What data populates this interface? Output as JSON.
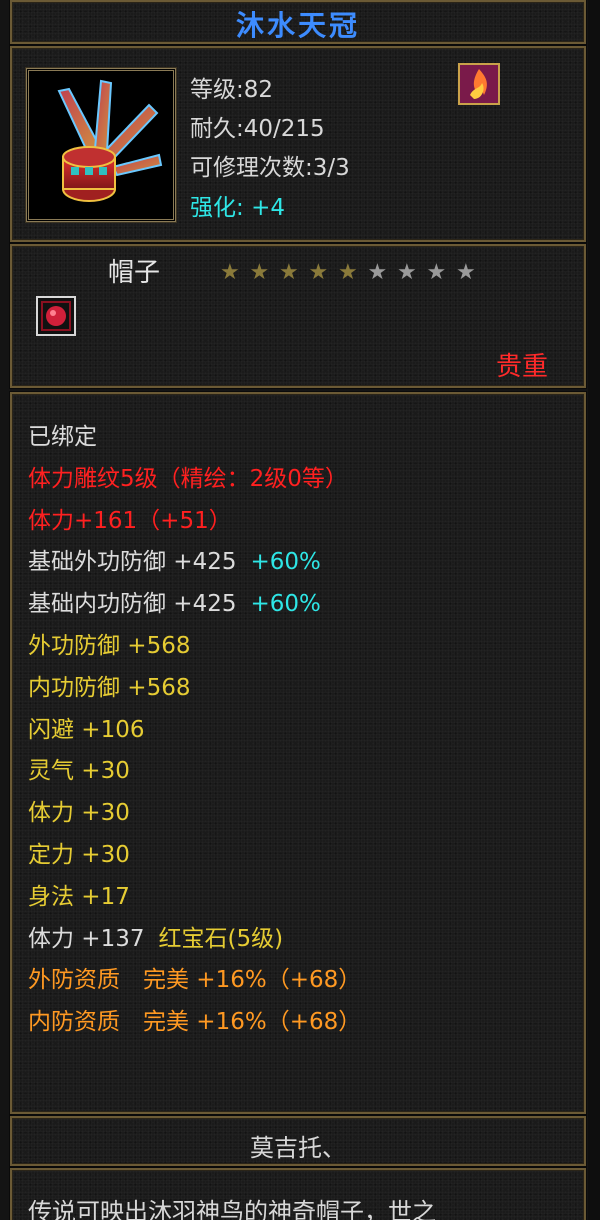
{
  "item": {
    "name": "沐水天冠",
    "level": "等级:82",
    "durability": "耐久:40/215",
    "repair": "可修理次数:3/3",
    "enhance_label": "强化:",
    "enhance_value": "+4",
    "type": "帽子",
    "stars_total": 9,
    "stars_filled": 5,
    "rarity": "贵重"
  },
  "attributes": [
    {
      "text": "已绑定",
      "color": "white"
    },
    {
      "text": "体力雕纹5级（精绘：2级0等）",
      "color": "red"
    },
    {
      "text": "体力+161（+51）",
      "color": "red"
    },
    {
      "text": "基础外功防御 +425",
      "extra": "+60%",
      "color": "white",
      "extra_color": "cyan"
    },
    {
      "text": "基础内功防御 +425",
      "extra": "+60%",
      "color": "white",
      "extra_color": "cyan"
    },
    {
      "text": "外功防御 +568",
      "color": "yellow"
    },
    {
      "text": "内功防御 +568",
      "color": "yellow"
    },
    {
      "text": "闪避 +106",
      "color": "yellow"
    },
    {
      "text": "灵气 +30",
      "color": "yellow"
    },
    {
      "text": "体力 +30",
      "color": "yellow"
    },
    {
      "text": "定力 +30",
      "color": "yellow"
    },
    {
      "text": "身法 +17",
      "color": "yellow"
    },
    {
      "text": "体力 +137",
      "extra": "红宝石(5级)",
      "color": "white",
      "extra_color": "yellow"
    },
    {
      "text": "外防资质　完美 +16%（+68）",
      "color": "orange"
    },
    {
      "text": "内防资质　完美 +16%（+68）",
      "color": "orange"
    }
  ],
  "creator": "莫吉托、",
  "description": "传说可映出沐羽神鸟的神奇帽子，世之",
  "colors": {
    "title": "#3d8cff",
    "enhance": "#2ee6e6",
    "rarity": "#ff2a2a",
    "frame": "#6b5a35"
  },
  "icons": {
    "item_icon": "feathered-crown-icon",
    "skill_badge": "flame-skill-icon",
    "set_icon": "red-gem-icon"
  }
}
